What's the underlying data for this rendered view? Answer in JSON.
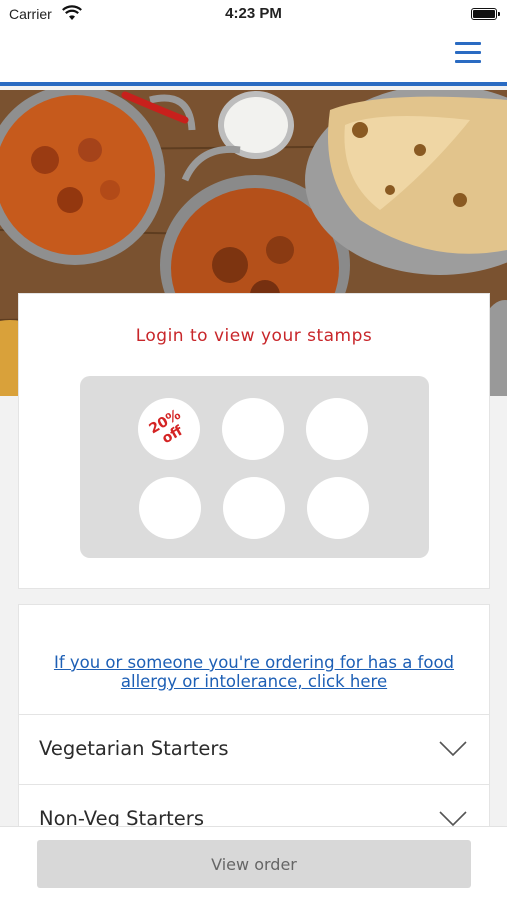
{
  "status_bar": {
    "carrier": "Carrier",
    "time": "4:23 PM"
  },
  "header": {
    "menu_icon": "hamburger-menu-icon",
    "accent_color": "#2a6bc2"
  },
  "loyalty": {
    "title": "Login to view your stamps",
    "reward_label": "20% off",
    "stamp_count": 6,
    "title_color": "#c8262a"
  },
  "menu": {
    "allergy_link": "If you or someone you're ordering for has a food allergy or intolerance, click here",
    "categories": [
      {
        "label": "Vegetarian Starters",
        "icon": "chevron-down-icon"
      },
      {
        "label": "Non-Veg Starters",
        "icon": "chevron-down-icon"
      }
    ]
  },
  "footer": {
    "view_order_label": "View order"
  }
}
